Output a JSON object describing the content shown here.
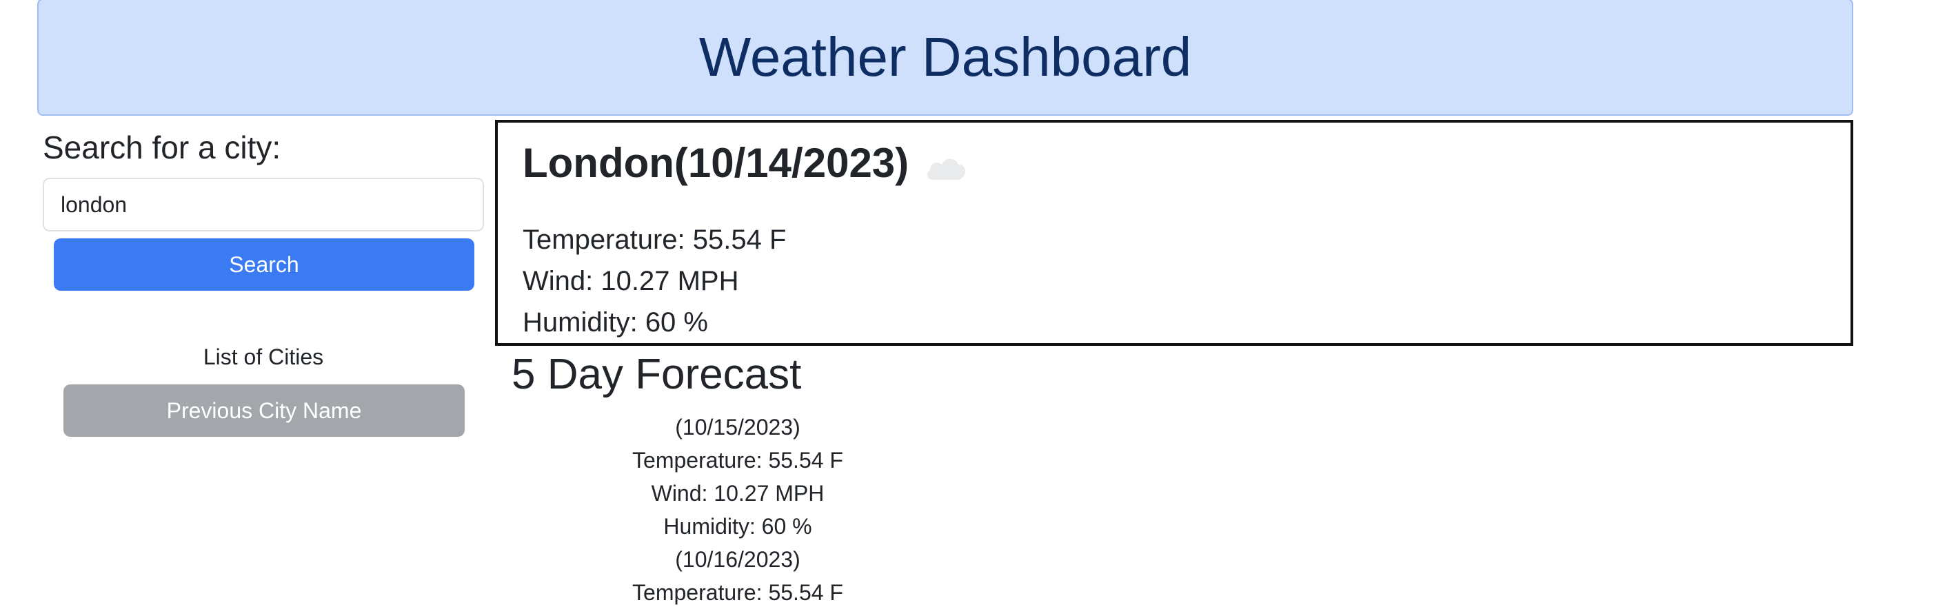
{
  "header": {
    "title": "Weather Dashboard"
  },
  "sidebar": {
    "search_label": "Search for a city:",
    "search_value": "london",
    "search_button": "Search",
    "cities_label": "List of Cities",
    "previous_city_button": "Previous City Name"
  },
  "current": {
    "title": "London(10/14/2023)",
    "icon": "cloud-icon",
    "temperature": "Temperature: 55.54 F",
    "wind": "Wind: 10.27 MPH",
    "humidity": "Humidity: 60 %"
  },
  "forecast": {
    "heading": "5 Day Forecast",
    "days": [
      {
        "date": "(10/15/2023)",
        "temperature": "Temperature: 55.54 F",
        "wind": "Wind: 10.27 MPH",
        "humidity": "Humidity: 60 %"
      },
      {
        "date": "(10/16/2023)",
        "temperature": "Temperature: 55.54 F"
      }
    ]
  },
  "colors": {
    "header_bg": "#cfe0fc",
    "header_text": "#0d2d63",
    "primary_button": "#3a7bf3",
    "secondary_button": "#a3a6ab"
  }
}
